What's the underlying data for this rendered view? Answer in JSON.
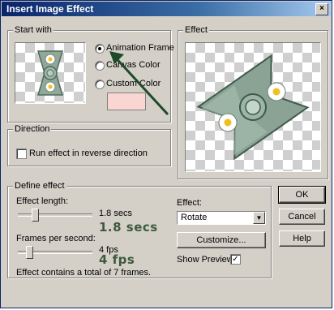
{
  "window": {
    "title": "Insert Image Effect"
  },
  "start_with": {
    "legend": "Start with",
    "options": [
      {
        "label": "Animation Frame",
        "selected": true
      },
      {
        "label": "Canvas Color",
        "selected": false
      },
      {
        "label": "Custom Color",
        "selected": false
      }
    ],
    "custom_color": "#f9d6d2"
  },
  "effect_preview": {
    "legend": "Effect"
  },
  "direction": {
    "legend": "Direction",
    "reverse_label": "Run effect in reverse direction",
    "reverse_checked": false
  },
  "define_effect": {
    "legend": "Define effect",
    "length_label": "Effect length:",
    "length_value": "1.8 secs",
    "length_big": "1.8 secs",
    "length_level": 0.2,
    "fps_label": "Frames per second:",
    "fps_value": "4 fps",
    "fps_big": "4 fps",
    "fps_level": 0.12,
    "summary": "Effect contains a total of 7 frames.",
    "effect_label": "Effect:",
    "effect_selected": "Rotate",
    "customize_label": "Customize...",
    "preview_label": "Show Preview",
    "preview_checked": true,
    "preview_check_glyph": "✓"
  },
  "buttons": {
    "ok": "OK",
    "cancel": "Cancel",
    "help": "Help"
  },
  "icons": {
    "close": "×",
    "dropdown": "▼"
  },
  "colors": {
    "annotation_arrow": "#1f4a2a",
    "big_text": "#3c5a3c"
  }
}
